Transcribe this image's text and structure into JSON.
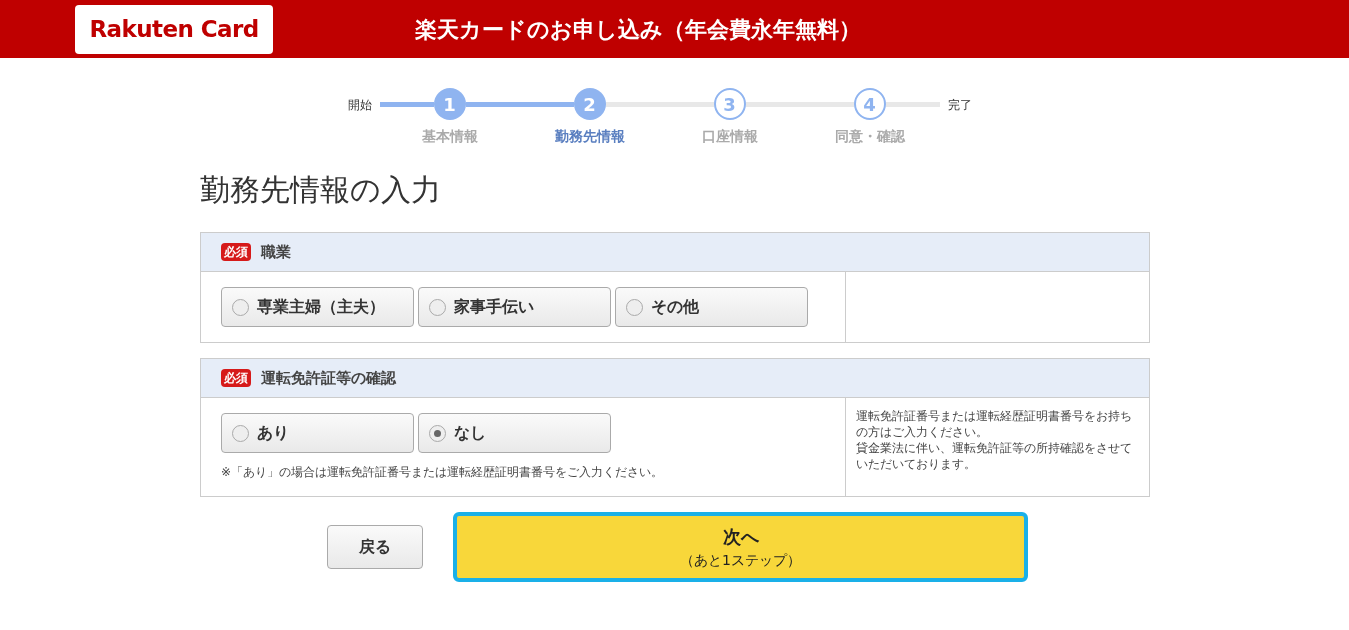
{
  "header": {
    "logo": "Rakuten Card",
    "title": "楽天カードのお申し込み（年会費永年無料）"
  },
  "progress": {
    "start": "開始",
    "end": "完了",
    "steps": [
      {
        "number": "1",
        "label": "基本情報",
        "reached": true,
        "selected": false
      },
      {
        "number": "2",
        "label": "勤務先情報",
        "reached": true,
        "selected": true
      },
      {
        "number": "3",
        "label": "口座情報",
        "reached": false,
        "selected": false
      },
      {
        "number": "4",
        "label": "同意・確認",
        "reached": false,
        "selected": false
      }
    ]
  },
  "heading": "勤務先情報の入力",
  "sections": [
    {
      "required": "必須",
      "title": "職業",
      "options": [
        {
          "label": "専業主婦（主夫）",
          "selected": false
        },
        {
          "label": "家事手伝い",
          "selected": false
        },
        {
          "label": "その他",
          "selected": false
        }
      ]
    },
    {
      "required": "必須",
      "title": "運転免許証等の確認",
      "options": [
        {
          "label": "あり",
          "selected": false
        },
        {
          "label": "なし",
          "selected": true
        }
      ],
      "note": "※「あり」の場合は運転免許証番号または運転経歴証明書番号をご入力ください。",
      "help": [
        "運転免許証番号または運転経歴証明書番号をお持ちの方はご入力ください。",
        "貸金業法に伴い、運転免許証等の所持確認をさせていただいております。"
      ]
    }
  ],
  "buttons": {
    "back": "戻る",
    "next": "次へ",
    "next_sub": "（あと1ステップ）"
  }
}
